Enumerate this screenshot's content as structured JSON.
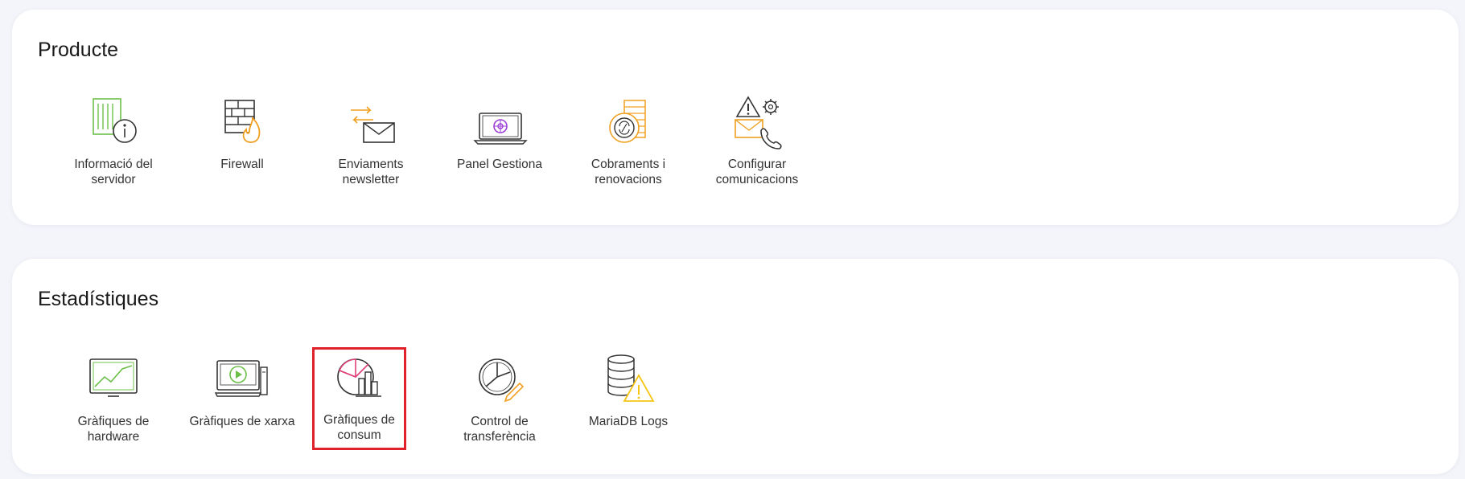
{
  "sections": [
    {
      "title": "Producte",
      "items": [
        {
          "label": "Informació del\nservidor",
          "icon": "server-info-icon"
        },
        {
          "label": "Firewall",
          "icon": "firewall-icon"
        },
        {
          "label": "Enviaments\nnewsletter",
          "icon": "newsletter-icon"
        },
        {
          "label": "Panel Gestiona",
          "icon": "panel-laptop-icon"
        },
        {
          "label": "Cobraments i\nrenovacions",
          "icon": "billing-icon"
        },
        {
          "label": "Configurar\ncomunicacions",
          "icon": "communications-settings-icon"
        }
      ]
    },
    {
      "title": "Estadístiques",
      "items": [
        {
          "label": "Gràfiques de\nhardware",
          "icon": "hardware-chart-icon"
        },
        {
          "label": "Gràfiques de xarxa",
          "icon": "network-chart-icon"
        },
        {
          "label": "Gràfiques de\nconsum",
          "icon": "consumption-chart-icon",
          "highlighted": true
        },
        {
          "label": "Control de\ntransferència",
          "icon": "transfer-control-icon"
        },
        {
          "label": "MariaDB Logs",
          "icon": "database-warning-icon"
        }
      ]
    }
  ],
  "colors": {
    "green": "#6cc04a",
    "orange": "#f0a020",
    "purple": "#9b3fd6",
    "pink": "#e0407a",
    "highlight": "#e0202a",
    "warning": "#f5c518"
  }
}
